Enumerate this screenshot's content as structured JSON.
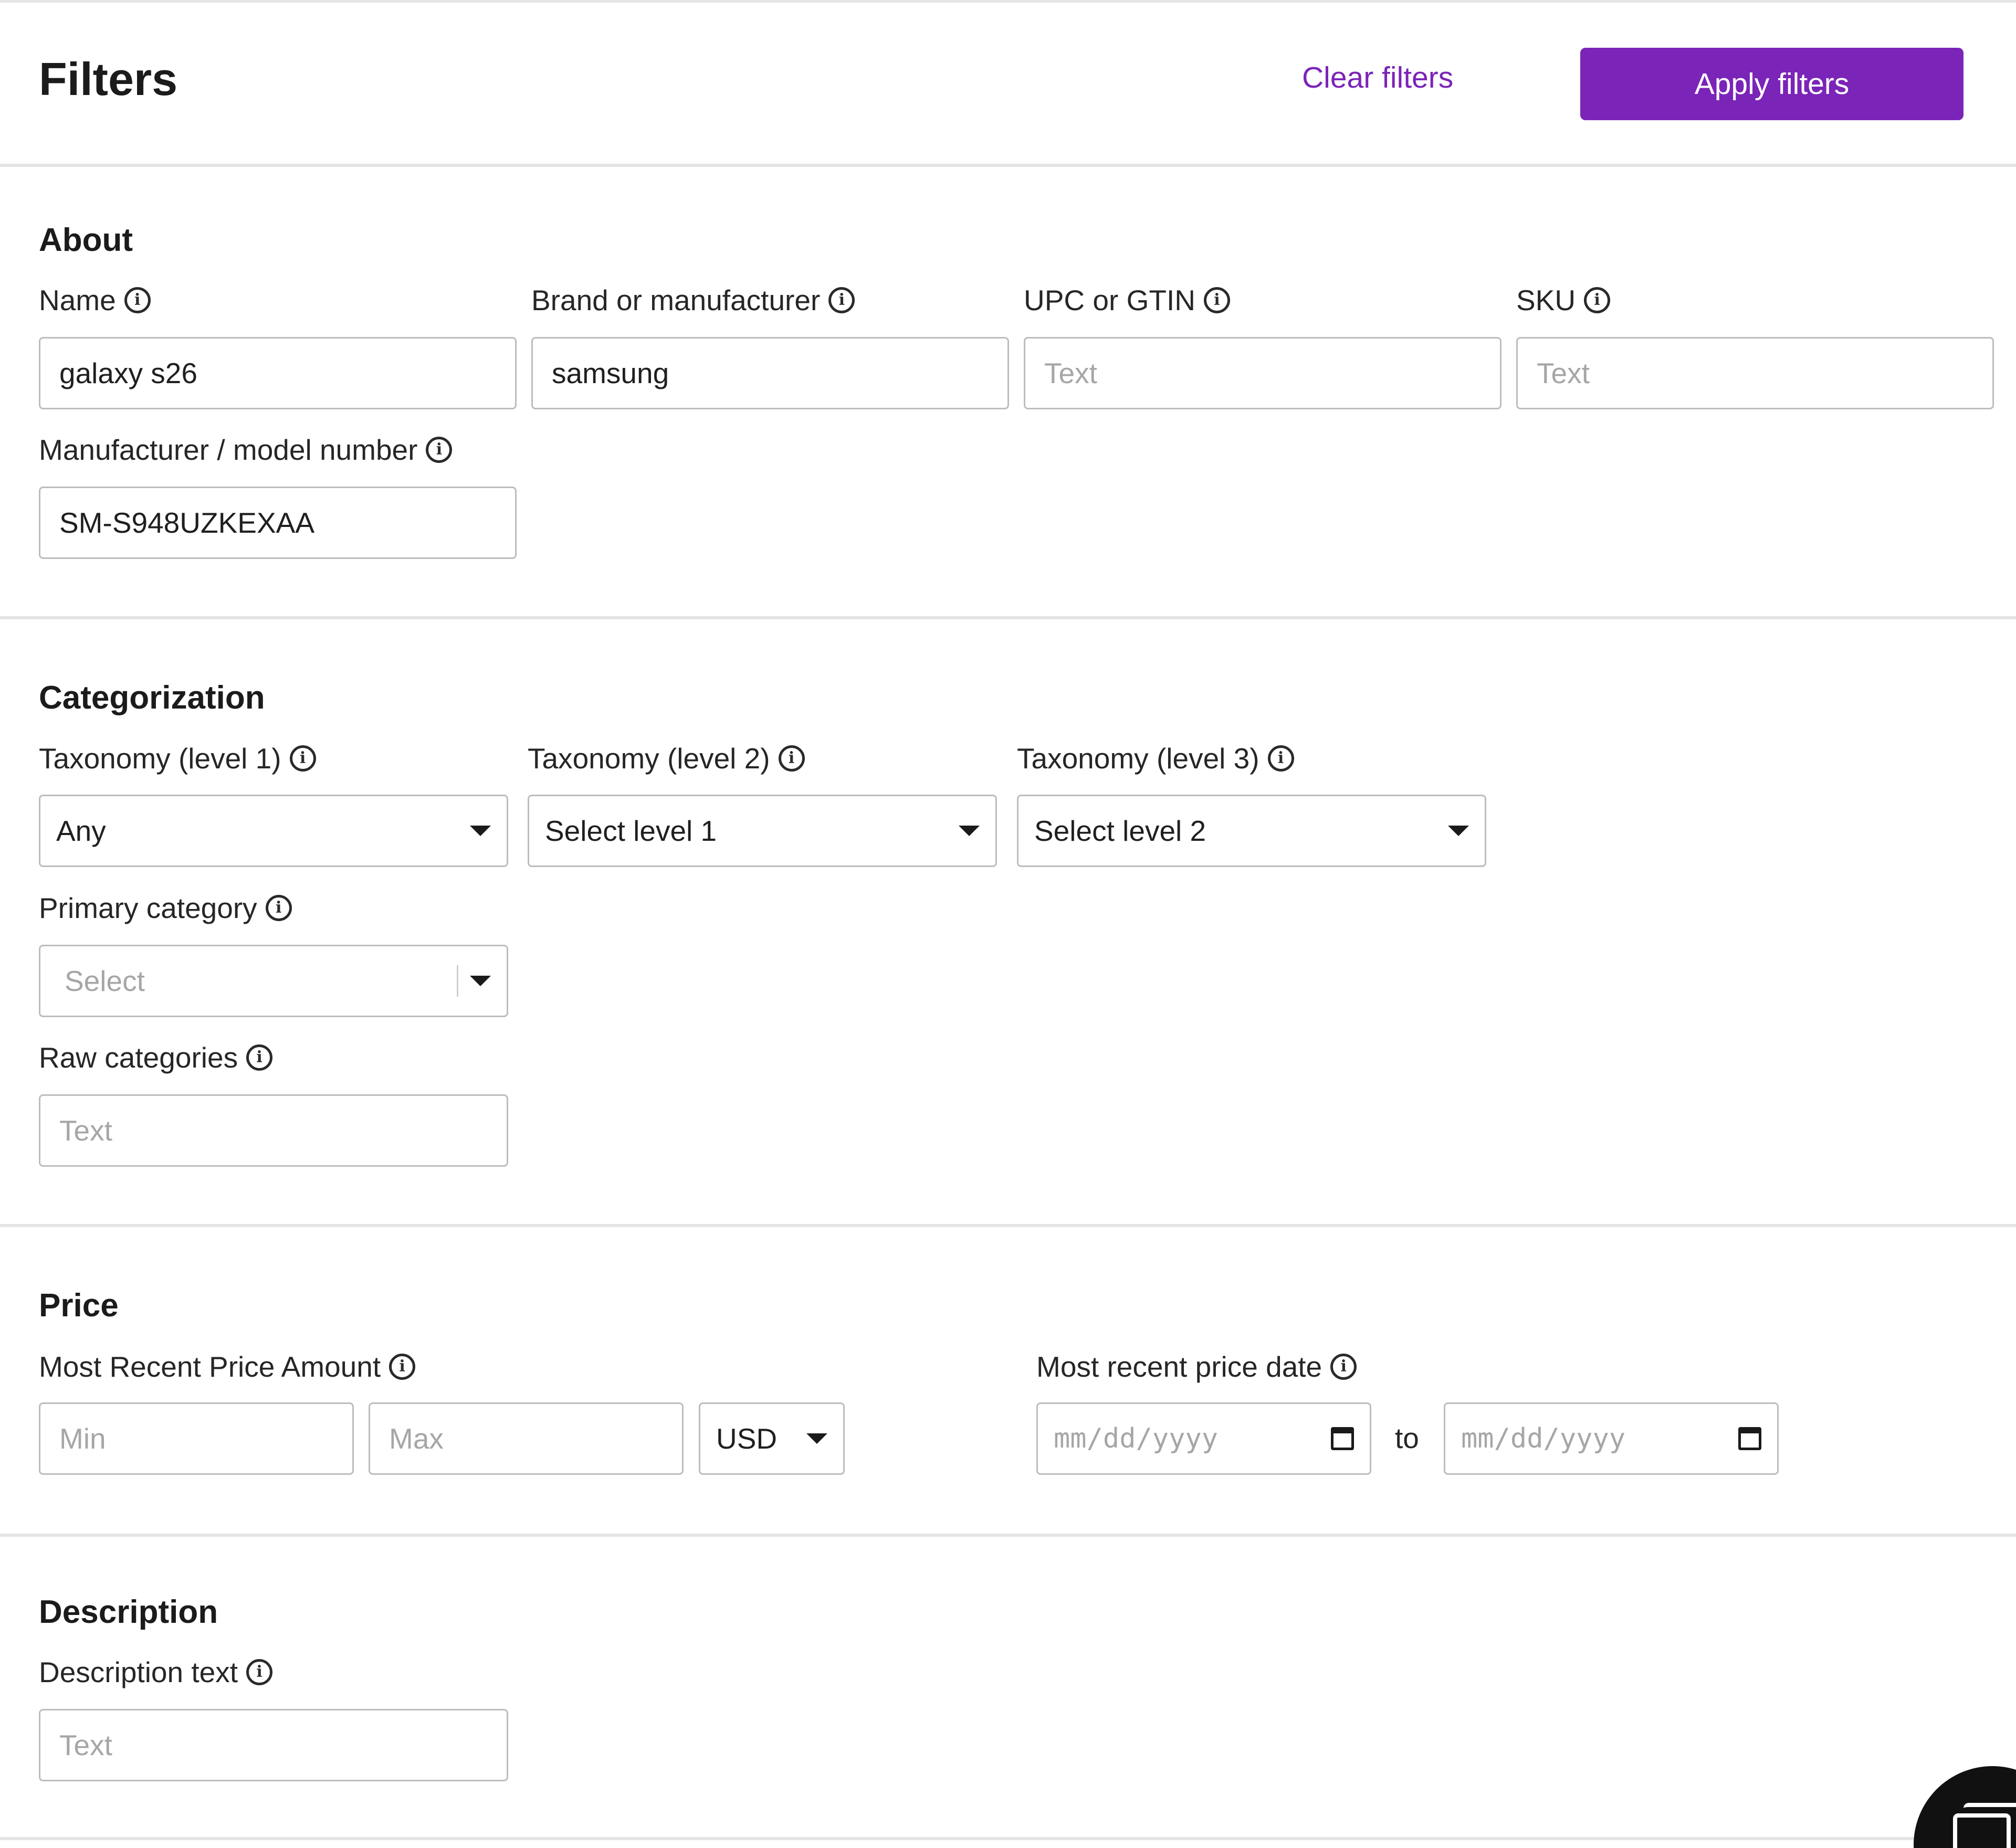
{
  "header": {
    "title": "Filters",
    "clear_label": "Clear filters",
    "apply_label": "Apply filters"
  },
  "about": {
    "title": "About",
    "name": {
      "label": "Name",
      "value": "galaxy s26"
    },
    "brand": {
      "label": "Brand or manufacturer",
      "value": "samsung"
    },
    "upc": {
      "label": "UPC or GTIN",
      "placeholder": "Text"
    },
    "sku": {
      "label": "SKU",
      "placeholder": "Text"
    },
    "model": {
      "label": "Manufacturer / model number",
      "value": "SM-S948UZKEXAA"
    }
  },
  "categorization": {
    "title": "Categorization",
    "tax1": {
      "label": "Taxonomy (level 1)",
      "value": "Any"
    },
    "tax2": {
      "label": "Taxonomy (level 2)",
      "value": "Select level 1"
    },
    "tax3": {
      "label": "Taxonomy (level 3)",
      "value": "Select level 2"
    },
    "primary": {
      "label": "Primary category",
      "placeholder": "Select"
    },
    "raw": {
      "label": "Raw categories",
      "placeholder": "Text"
    }
  },
  "price": {
    "title": "Price",
    "amount_label": "Most Recent Price Amount",
    "min_placeholder": "Min",
    "max_placeholder": "Max",
    "currency": "USD",
    "date_label": "Most recent price date",
    "date_placeholder": "mm/dd/yyyy",
    "to_label": "to"
  },
  "description": {
    "title": "Description",
    "text": {
      "label": "Description text",
      "placeholder": "Text"
    }
  },
  "icons": {
    "info": "info-icon",
    "caret": "caret-down-icon",
    "calendar": "calendar-icon",
    "fab": "windows-icon"
  },
  "colors": {
    "accent": "#7b24b8"
  },
  "info_glyph": "i"
}
